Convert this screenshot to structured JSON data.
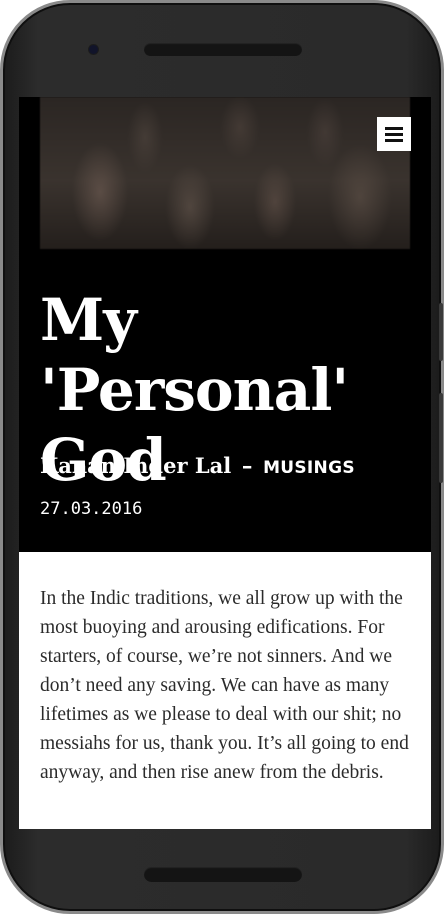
{
  "article": {
    "title": "My 'Personal' God",
    "author": "Kanan Inder Lal",
    "separator": "–",
    "category": "MUSINGS",
    "date": "27.03.2016",
    "body": "In the Indic traditions, we all grow up with the most buoying and arousing edifications. For starters, of course, we’re not sinners. And we don’t need any saving. We can have as many lifetimes as we please to deal with our shit; no messiahs for us, thank you. It’s all going to end anyway, and then rise anew from the debris."
  },
  "icons": {
    "menu": "hamburger-menu-icon"
  },
  "colors": {
    "header_background": "#000000",
    "header_text": "#ffffff",
    "content_background": "#ffffff",
    "body_text": "#2b2b2b",
    "menu_button_background": "#ffffff"
  }
}
